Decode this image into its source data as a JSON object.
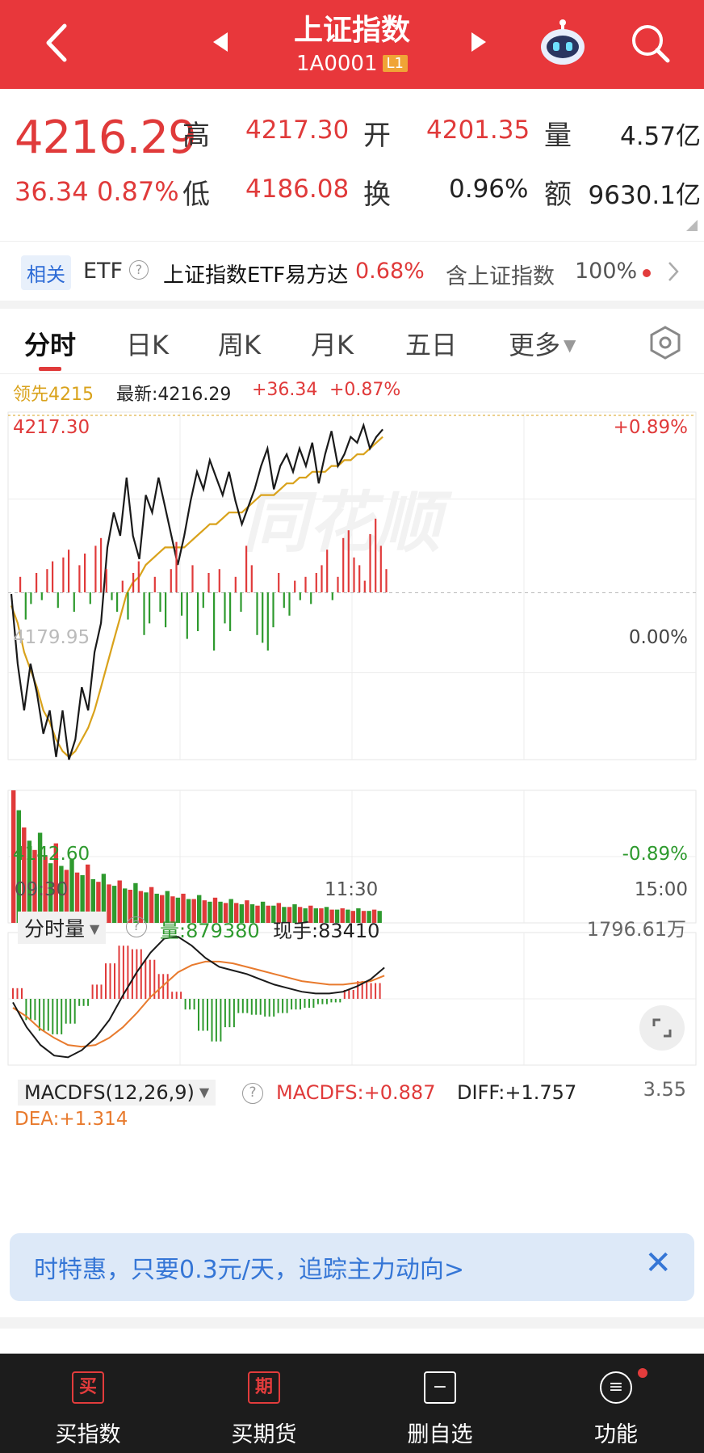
{
  "header": {
    "title": "上证指数",
    "code": "1A0001",
    "level": "L1"
  },
  "quote": {
    "price": "4216.29",
    "change": "36.34",
    "change_pct": "0.87%",
    "high_label": "高",
    "high": "4217.30",
    "low_label": "低",
    "low": "4186.08",
    "open_label": "开",
    "open": "4201.35",
    "turnover_label": "换",
    "turnover": "0.96%",
    "volume_label": "量",
    "volume": "4.57亿",
    "amount_label": "额",
    "amount": "9630.1亿"
  },
  "etf": {
    "tag": "相关",
    "type": "ETF",
    "help": "?",
    "name": "上证指数ETF易方达",
    "pct": "0.68%",
    "holding_label": "含上证指数",
    "holding": "100%"
  },
  "tabs": [
    "分时",
    "日K",
    "周K",
    "月K",
    "五日",
    "更多"
  ],
  "intraday": {
    "leader": "领先4215",
    "latest": "最新:4216.29",
    "change": "+36.34",
    "change_pct": "+0.87%",
    "top_price": "4217.30",
    "top_pct": "+0.89%",
    "mid_price": "4179.95",
    "mid_pct": "0.00%",
    "bottom_price": "4142.60",
    "bottom_pct": "-0.89%",
    "time_start": "09:30",
    "time_mid": "11:30",
    "time_end": "15:00",
    "watermark": "同花顺"
  },
  "volume_panel": {
    "selector": "分时量",
    "help": "?",
    "vol_label": "量:879380",
    "hand_label": "现手:83410",
    "max": "1796.61万"
  },
  "macd_panel": {
    "selector": "MACDFS(12,26,9)",
    "help": "?",
    "macdfs": "MACDFS:+0.887",
    "diff": "DIFF:+1.757",
    "dea": "DEA:+1.314",
    "max": "3.55"
  },
  "promo": {
    "text": "时特惠，只要0.3元/天，追踪主力动向>",
    "close": "✕"
  },
  "bottom_nav": [
    {
      "icon": "买",
      "label": "买指数"
    },
    {
      "icon": "期",
      "label": "买期货"
    },
    {
      "icon": "−",
      "label": "删自选"
    },
    {
      "icon": "≡",
      "label": "功能"
    }
  ],
  "colors": {
    "brand_red": "#e8373b",
    "up": "#e03a3a",
    "down": "#2e9a2e",
    "avg_line": "#d9a21b",
    "link_blue": "#3576d6"
  },
  "chart_data": [
    {
      "type": "line",
      "title": "分时",
      "series": [
        {
          "values": [
            4188,
            4176,
            4168,
            4176,
            4171,
            4164,
            4168,
            4160,
            4168,
            4155,
            4163,
            4172,
            4168,
            4178,
            4183,
            4196,
            4202,
            4198,
            4208,
            4198,
            4194,
            4205,
            4202,
            4208,
            4203,
            4198,
            4193,
            4198,
            4204,
            4209,
            4206,
            4211,
            4208,
            4205,
            4209,
            4204,
            4200,
            4203,
            4206,
            4210,
            4213,
            4206,
            4210,
            4212,
            4209,
            4213,
            4210,
            4214,
            4207,
            4212,
            4216,
            4210,
            4212,
            4215,
            4214,
            4217,
            4213,
            4215,
            4216.29
          ]
        },
        {
          "values": [
            4186,
            4183,
            4178,
            4175,
            4172,
            4168,
            4166,
            4163,
            4161,
            4160,
            4161,
            4163,
            4165,
            4168,
            4172,
            4176,
            4180,
            4184,
            4188,
            4190,
            4191,
            4193,
            4194,
            4195,
            4196,
            4196,
            4196,
            4196,
            4197,
            4198,
            4199,
            4200,
            4200,
            4201,
            4202,
            4202,
            4202,
            4203,
            4204,
            4205,
            4205,
            4205,
            4206,
            4207,
            4207,
            4208,
            4208,
            4209,
            4209,
            4209,
            4210,
            4210,
            4211,
            4211,
            4212,
            4212,
            4213,
            4214,
            4215
          ]
        }
      ],
      "ylim": [
        4142.6,
        4217.3
      ]
    },
    {
      "type": "bar",
      "title": "分时量",
      "values": [
        100,
        85,
        72,
        62,
        55,
        68,
        50,
        45,
        60,
        43,
        40,
        48,
        38,
        36,
        44,
        33,
        31,
        37,
        29,
        28,
        32,
        26,
        25,
        30,
        24,
        23,
        27,
        22,
        21,
        24,
        20,
        19,
        22,
        18,
        18,
        21,
        17,
        16,
        19,
        16,
        15,
        18,
        15,
        14,
        17,
        14,
        13,
        16,
        13,
        13,
        15,
        12,
        12,
        14,
        12,
        11,
        13,
        11,
        11,
        12,
        10,
        10,
        11,
        10,
        9,
        11,
        9,
        9,
        10,
        9
      ],
      "ylim": [
        0,
        100
      ]
    },
    {
      "type": "line",
      "title": "MACDFS(12,26,9)",
      "series": [
        {
          "name": "DIFF",
          "values": [
            -0.2,
            -1.6,
            -2.6,
            -3.2,
            -3.3,
            -2.9,
            -2.2,
            -1.2,
            0.2,
            1.5,
            2.6,
            3.4,
            3.5,
            3.0,
            2.3,
            1.8,
            1.6,
            1.4,
            1.1,
            0.8,
            0.6,
            0.4,
            0.3,
            0.3,
            0.4,
            0.7,
            1.1,
            1.76
          ]
        },
        {
          "name": "DEA",
          "values": [
            -0.5,
            -1.0,
            -1.7,
            -2.2,
            -2.6,
            -2.7,
            -2.6,
            -2.2,
            -1.6,
            -0.8,
            0.1,
            0.8,
            1.5,
            1.9,
            2.1,
            2.1,
            2.0,
            1.8,
            1.6,
            1.4,
            1.2,
            1.0,
            0.9,
            0.8,
            0.8,
            0.9,
            1.0,
            1.31
          ]
        }
      ],
      "values": [
        0.6,
        -1.2,
        -1.8,
        -2.0,
        -1.4,
        -0.4,
        0.8,
        2.0,
        3.0,
        2.8,
        2.2,
        1.4,
        0.4,
        -0.6,
        -1.8,
        -2.4,
        -1.6,
        -0.8,
        -0.9,
        -1.0,
        -0.8,
        -0.6,
        -0.5,
        -0.3,
        -0.2,
        0.5,
        1.0,
        0.89
      ],
      "ylim": [
        -3.55,
        3.55
      ]
    }
  ]
}
